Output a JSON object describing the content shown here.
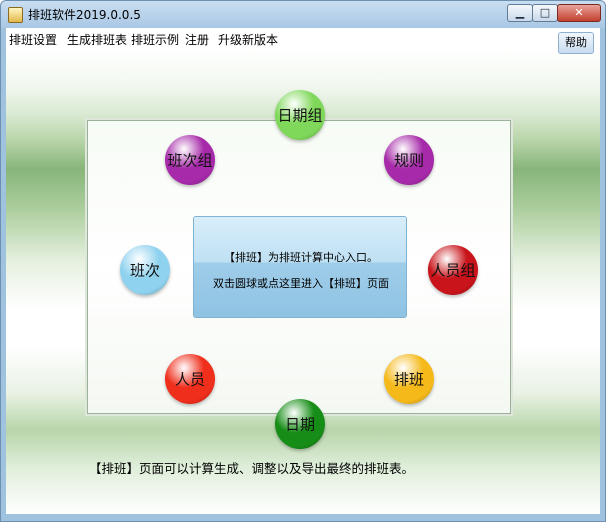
{
  "window": {
    "title": "排班软件2019.0.0.5",
    "min_glyph": "▁",
    "max_glyph": "□",
    "close_glyph": "✕"
  },
  "menu": {
    "items": [
      "排班设置",
      "生成排班表",
      "排班示例",
      "注册",
      "升级新版本"
    ],
    "help": "帮助"
  },
  "balls": {
    "date_group": {
      "label": "日期组",
      "color": "#7fd85a"
    },
    "rule": {
      "label": "规则",
      "color": "#a62aa9"
    },
    "shift_group": {
      "label": "班次组",
      "color": "#a62aa9"
    },
    "shift": {
      "label": "班次",
      "color": "#8fd2ef"
    },
    "staff_group": {
      "label": "人员组",
      "color": "#c8141a"
    },
    "staff": {
      "label": "人员",
      "color": "#ef2e1c"
    },
    "schedule": {
      "label": "排班",
      "color": "#f5b91a"
    },
    "date": {
      "label": "日期",
      "color": "#168d16"
    }
  },
  "center_panel": {
    "line1": "【排班】为排班计算中心入口。",
    "line2": "双击圆球或点这里进入【排班】页面"
  },
  "footer": "【排班】页面可以计算生成、调整以及导出最终的排班表。"
}
